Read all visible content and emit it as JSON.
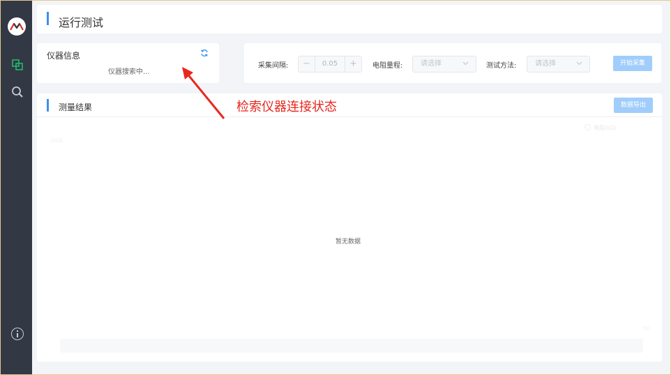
{
  "app": {
    "page_title": "运行测试"
  },
  "sidebar": {
    "items": [
      {
        "icon": "layers-icon"
      },
      {
        "icon": "search-icon"
      },
      {
        "icon": "info-icon"
      }
    ],
    "active_color": "#20b86e"
  },
  "device": {
    "title": "仪器信息",
    "status": "仪器搜索中..."
  },
  "controls": {
    "interval_label": "采集间隔:",
    "interval_value": "0.05",
    "resistance_label": "电阻量程:",
    "resistance_placeholder": "请选择",
    "method_label": "测试方法:",
    "method_placeholder": "请选择",
    "start_button": "开始采集"
  },
  "results": {
    "title": "测量结果",
    "export_button": "数据导出",
    "legend": "电阻(kΩ)",
    "y_axis_label": "(kΩ)",
    "x_axis_label": "(s)",
    "empty_text": "暂无数据"
  },
  "annotation": {
    "text": "检索仪器连接状态",
    "color": "#e8271f"
  },
  "colors": {
    "sidebar_bg": "#333845",
    "accent": "#3d8ff0",
    "button_disabled": "#a0cdfb"
  }
}
